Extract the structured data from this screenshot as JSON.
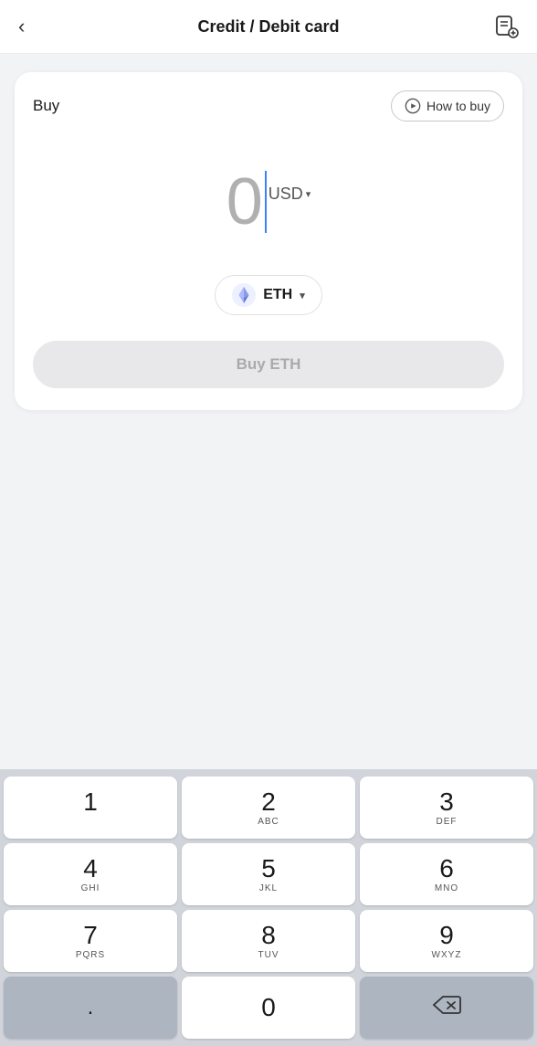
{
  "header": {
    "back_label": "<",
    "title": "Credit / Debit card",
    "settings_icon": "settings-icon"
  },
  "card": {
    "buy_label": "Buy",
    "how_to_buy_label": "How to buy",
    "amount_value": "0",
    "currency": "USD",
    "currency_chevron": "▾",
    "crypto": {
      "symbol": "ETH",
      "chevron": "▾"
    },
    "buy_button_label": "Buy ETH"
  },
  "keyboard": {
    "rows": [
      [
        {
          "number": "1",
          "letters": ""
        },
        {
          "number": "2",
          "letters": "ABC"
        },
        {
          "number": "3",
          "letters": "DEF"
        }
      ],
      [
        {
          "number": "4",
          "letters": "GHI"
        },
        {
          "number": "5",
          "letters": "JKL"
        },
        {
          "number": "6",
          "letters": "MNO"
        }
      ],
      [
        {
          "number": "7",
          "letters": "PQRS"
        },
        {
          "number": "8",
          "letters": "TUV"
        },
        {
          "number": "9",
          "letters": "WXYZ"
        }
      ],
      [
        {
          "number": ".",
          "letters": "",
          "type": "dot"
        },
        {
          "number": "0",
          "letters": ""
        },
        {
          "number": "⌫",
          "letters": "",
          "type": "backspace"
        }
      ]
    ]
  }
}
